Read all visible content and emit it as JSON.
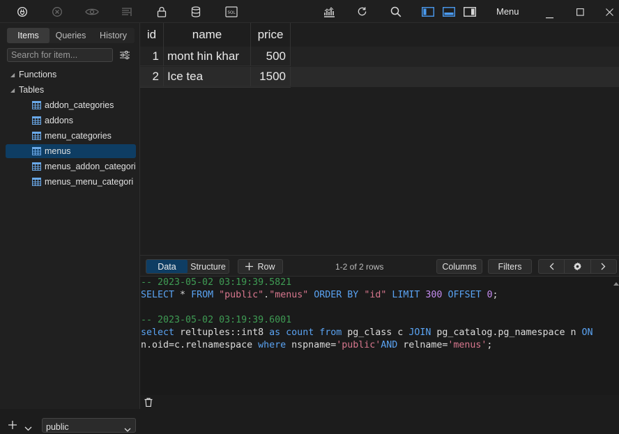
{
  "toolbar": {
    "menu_label": "Menu"
  },
  "sidebar": {
    "tabs": [
      {
        "label": "Items",
        "active": true
      },
      {
        "label": "Queries",
        "active": false
      },
      {
        "label": "History",
        "active": false
      }
    ],
    "search_placeholder": "Search for item...",
    "groups": [
      {
        "label": "Functions"
      },
      {
        "label": "Tables"
      }
    ],
    "tables": [
      {
        "label": "addon_categories",
        "selected": false
      },
      {
        "label": "addons",
        "selected": false
      },
      {
        "label": "menu_categories",
        "selected": false
      },
      {
        "label": "menus",
        "selected": true
      },
      {
        "label": "menus_addon_categori",
        "selected": false
      },
      {
        "label": "menus_menu_categori",
        "selected": false
      }
    ],
    "schema": "public"
  },
  "grid": {
    "columns": [
      "id",
      "name",
      "price"
    ],
    "rows": [
      [
        "1",
        "mont hin khar",
        "500"
      ],
      [
        "2",
        "Ice tea",
        "1500"
      ]
    ]
  },
  "bar": {
    "data_tab": "Data",
    "structure_tab": "Structure",
    "add_row": "Row",
    "row_count": "1-2 of 2 rows",
    "columns_btn": "Columns",
    "filters_btn": "Filters"
  },
  "console": {
    "comment1": "-- 2023-05-02 03:19:39.5821",
    "comment2": "-- 2023-05-02 03:19:39.6001",
    "q1": {
      "select": "SELECT",
      "star": " * ",
      "from": "FROM",
      "s1": "\"public\"",
      "dot": ".",
      "s2": "\"menus\"",
      "order": "ORDER BY",
      "s3": "\"id\"",
      "limit": "LIMIT",
      "n1": "300",
      "offset": "OFFSET",
      "n2": "0",
      "end": ";"
    },
    "q2": {
      "select": "select",
      "p1": " reltuples::int8 ",
      "as": "as",
      "count": "count",
      "from": "from",
      "p2": " pg_class c ",
      "join": "JOIN",
      "p3": " pg_catalog.pg_namespace n ",
      "on": "ON",
      "p4": "n.oid=c.relnamespace ",
      "where": "where",
      "p5": " nspname=",
      "s1": "'public'",
      "and": "AND",
      "p6": " relname=",
      "s2": "'menus'",
      "end": ";"
    }
  },
  "colors": {
    "accent": "#0e3d63",
    "comment": "#3f9c54",
    "keyword": "#5aa3f2",
    "string": "#d8778e",
    "number": "#c58cf0"
  }
}
